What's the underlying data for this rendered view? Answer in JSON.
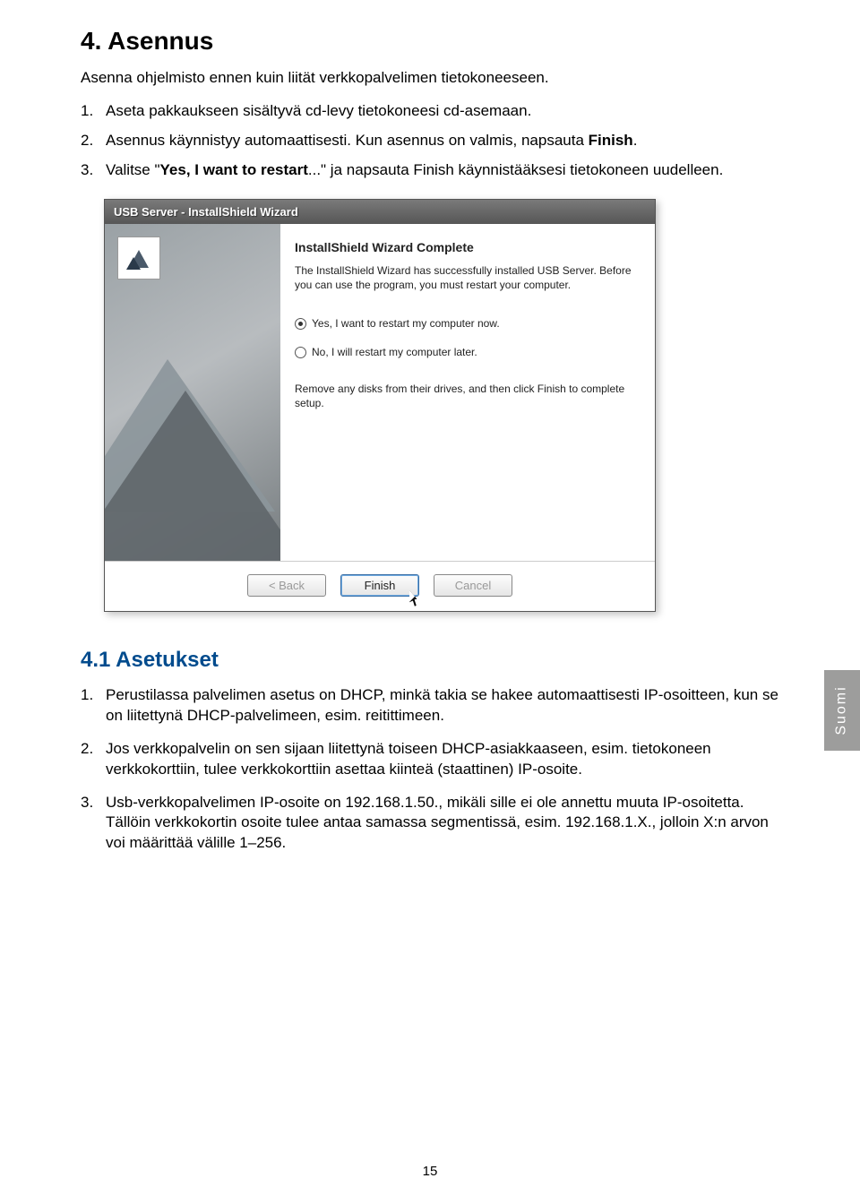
{
  "section_title": "4. Asennus",
  "intro": "Asenna ohjelmisto ennen kuin liität verkkopalvelimen tietokoneeseen.",
  "steps": [
    {
      "text_a": "Aseta pakkaukseen sisältyvä cd-levy tietokoneesi cd-asemaan."
    },
    {
      "text_a": "Asennus käynnistyy automaattisesti. Kun asennus on valmis, napsauta ",
      "bold": "Finish",
      "text_b": "."
    },
    {
      "text_a": "Valitse \"",
      "bold": "Yes, I want to restart",
      "text_b": "...\" ja napsauta Finish käynnistääksesi tietokoneen uudelleen."
    }
  ],
  "installer": {
    "title": "USB Server - InstallShield Wizard",
    "heading": "InstallShield Wizard Complete",
    "description": "The InstallShield Wizard has successfully installed USB Server. Before you can use the program, you must restart your computer.",
    "radio_yes": "Yes, I want to restart my computer now.",
    "radio_no": "No, I will restart my computer later.",
    "remove_text": "Remove any disks from their drives, and then click Finish to complete setup.",
    "buttons": {
      "back": "< Back",
      "finish": "Finish",
      "cancel": "Cancel"
    }
  },
  "lang_tab": "Suomi",
  "subsection_title": "4.1 Asetukset",
  "settings": [
    "Perustilassa palvelimen asetus on DHCP, minkä takia se hakee automaattisesti IP-osoitteen, kun se on liitettynä DHCP-palvelimeen, esim. reitittimeen.",
    "Jos verkkopalvelin on sen sijaan liitettynä toiseen DHCP-asiakkaaseen, esim. tietokoneen verkkokorttiin, tulee verkkokorttiin asettaa kiinteä (staattinen) IP-osoite.",
    "Usb-verkkopalvelimen IP-osoite on 192.168.1.50., mikäli sille ei ole annettu muuta IP-osoitetta. Tällöin verkkokortin osoite tulee antaa samassa segmentissä, esim. 192.168.1.X., jolloin X:n arvon voi määrittää välille 1–256."
  ],
  "page_number": "15"
}
